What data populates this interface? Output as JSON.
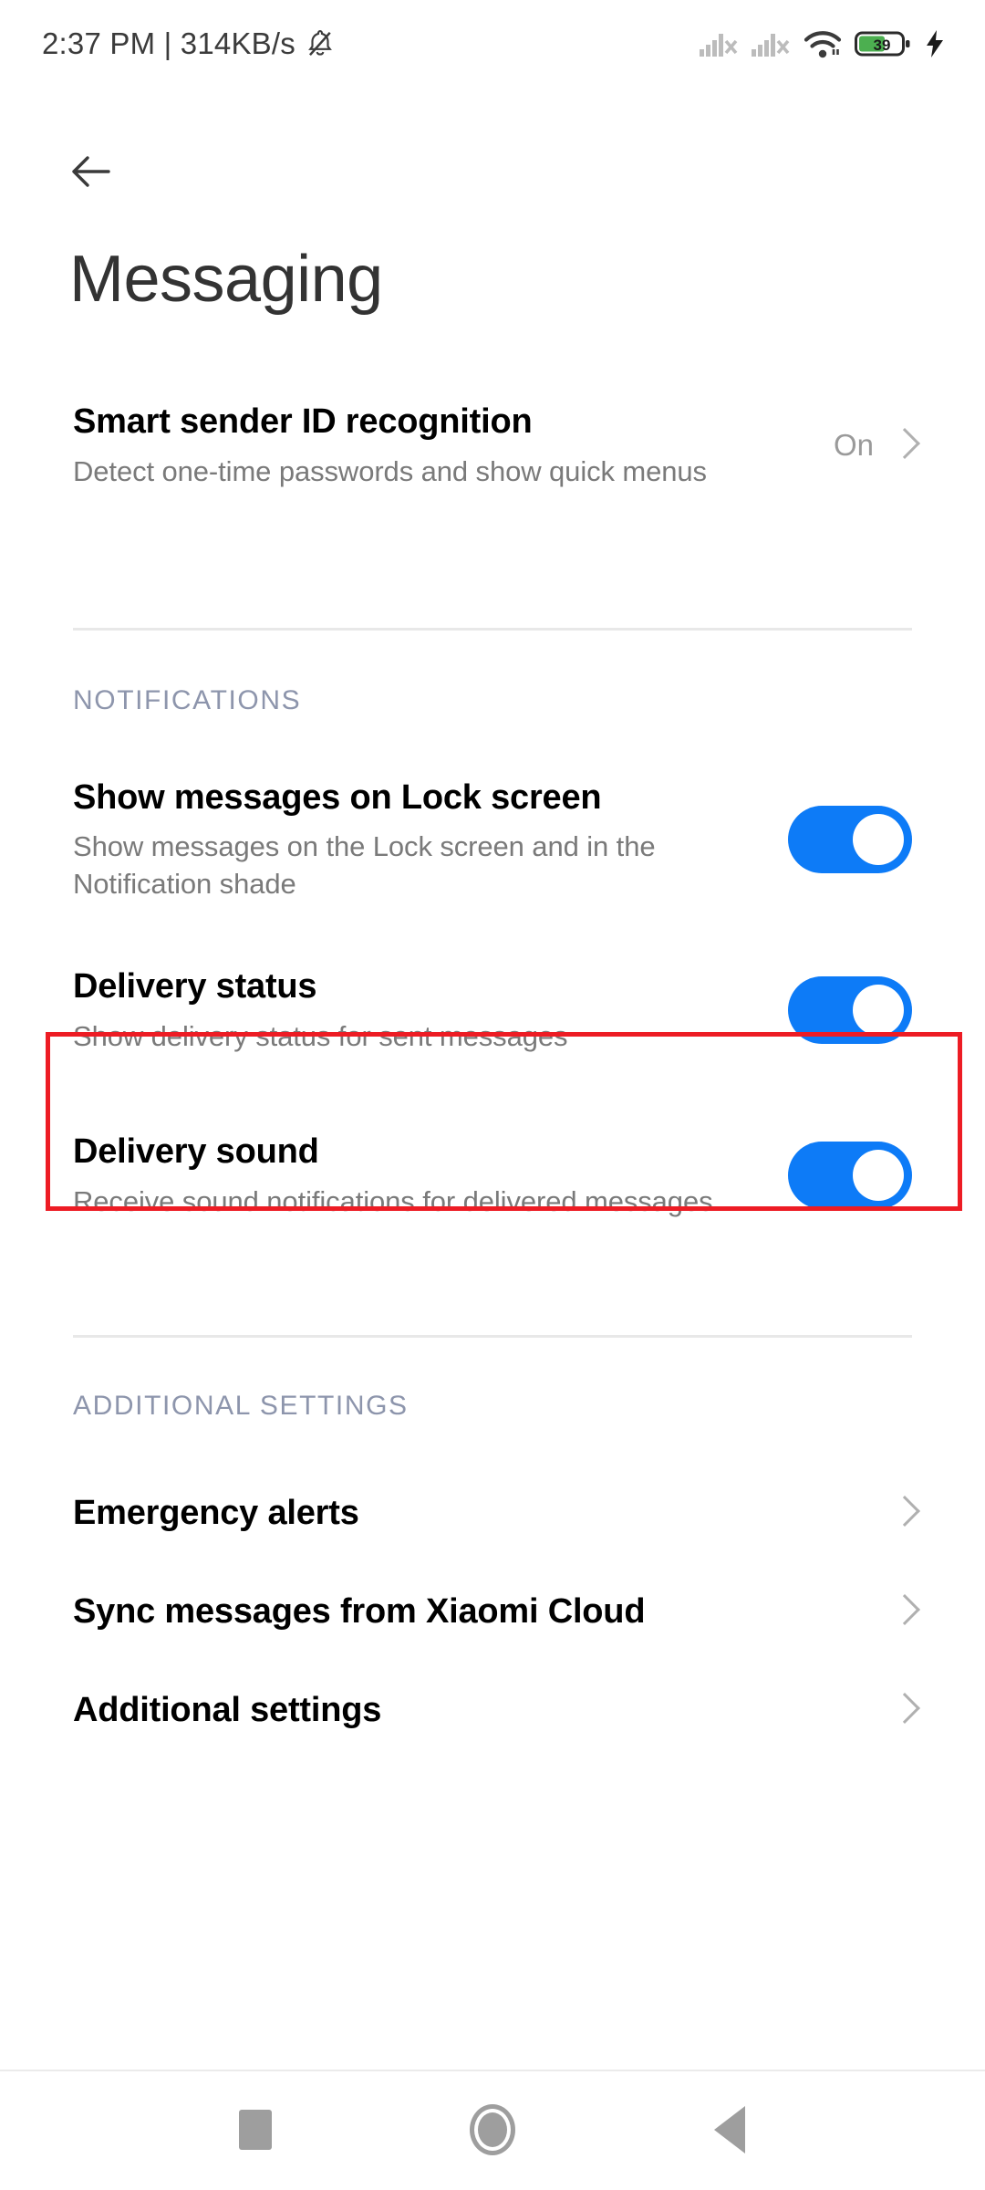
{
  "status_bar": {
    "time_and_speed": "2:37 PM | 314KB/s",
    "mute_icon": "bell-mute-icon",
    "signal1_icon": "signal-no-sim-icon",
    "signal2_icon": "signal-no-sim-icon",
    "wifi_icon": "wifi-icon",
    "battery_level": "39",
    "charging_icon": "charging-bolt-icon"
  },
  "header": {
    "back_icon": "back-arrow-icon",
    "title": "Messaging"
  },
  "smart_sender": {
    "title": "Smart sender ID recognition",
    "subtitle": "Detect one-time passwords and show quick menus",
    "value": "On",
    "chevron_icon": "chevron-right-icon"
  },
  "sections": [
    {
      "header": "NOTIFICATIONS",
      "items": [
        {
          "title": "Show messages on Lock screen",
          "subtitle": "Show messages on the Lock screen and in the Notification shade",
          "toggle": "on"
        },
        {
          "title": "Delivery status",
          "subtitle": "Show delivery status for sent messages",
          "toggle": "on",
          "highlighted": true
        },
        {
          "title": "Delivery sound",
          "subtitle": "Receive sound notifications for delivered messages.",
          "toggle": "on"
        }
      ]
    },
    {
      "header": "ADDITIONAL SETTINGS",
      "items": [
        {
          "title": "Emergency alerts",
          "chevron_icon": "chevron-right-icon"
        },
        {
          "title": "Sync messages from Xiaomi Cloud",
          "chevron_icon": "chevron-right-icon"
        },
        {
          "title": "Additional settings",
          "chevron_icon": "chevron-right-icon"
        }
      ]
    }
  ],
  "nav_bar": {
    "recents_icon": "square-recents-icon",
    "home_icon": "circle-home-icon",
    "back_icon": "triangle-back-icon"
  },
  "colors": {
    "toggle_on": "#0d7bf7",
    "highlight": "#ed1c24",
    "section_header": "#8d95ac",
    "battery_fill": "#4caf50"
  }
}
